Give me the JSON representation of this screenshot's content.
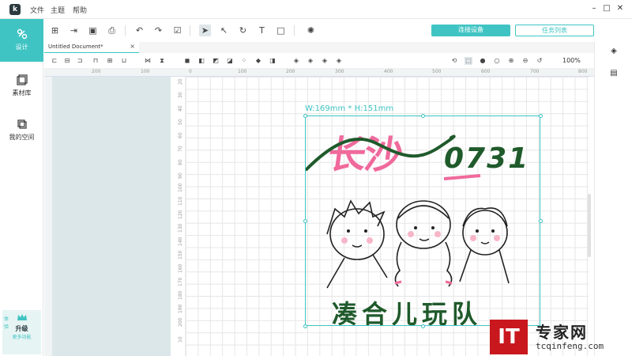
{
  "app": {
    "logo_letter": "k",
    "menu": [
      "文件",
      "主题",
      "帮助"
    ],
    "window_controls": [
      "–",
      "□",
      "✕"
    ]
  },
  "sidebar": {
    "items": [
      {
        "label": "设计",
        "icon": "design-icon",
        "active": true
      },
      {
        "label": "素材库",
        "icon": "gallery-icon",
        "active": false
      },
      {
        "label": "我的空间",
        "icon": "space-icon",
        "active": false
      }
    ],
    "upgrade": {
      "title": "升级",
      "line1": "体验",
      "line2": "更多功能"
    }
  },
  "toolbar": {
    "connect_label": "连接设备",
    "tasks_label": "任务列表"
  },
  "document": {
    "tab_name": "Untitled Document*",
    "close_glyph": "×",
    "zoom": "100%"
  },
  "rulers": {
    "top": [
      "200",
      "100",
      "0",
      "100",
      "200",
      "300",
      "400",
      "500",
      "600",
      "700",
      "800"
    ],
    "left": [
      "20",
      "30",
      "40",
      "50",
      "60",
      "70",
      "80",
      "90",
      "100",
      "110",
      "120",
      "130",
      "140",
      "150",
      "160",
      "170",
      "180",
      "190",
      "200",
      "10"
    ]
  },
  "canvas": {
    "dimension_label": "W:169mm * H:151mm",
    "city_text": "长沙",
    "code_text": "0731",
    "slogan_text": "凑合儿玩队"
  },
  "watermark": {
    "badge": "IT",
    "name": "专家网",
    "url": "tcqinfeng.com"
  },
  "colors": {
    "accent": "#3fc4c3",
    "pink": "#f06a9c",
    "green": "#1f5a2b"
  }
}
